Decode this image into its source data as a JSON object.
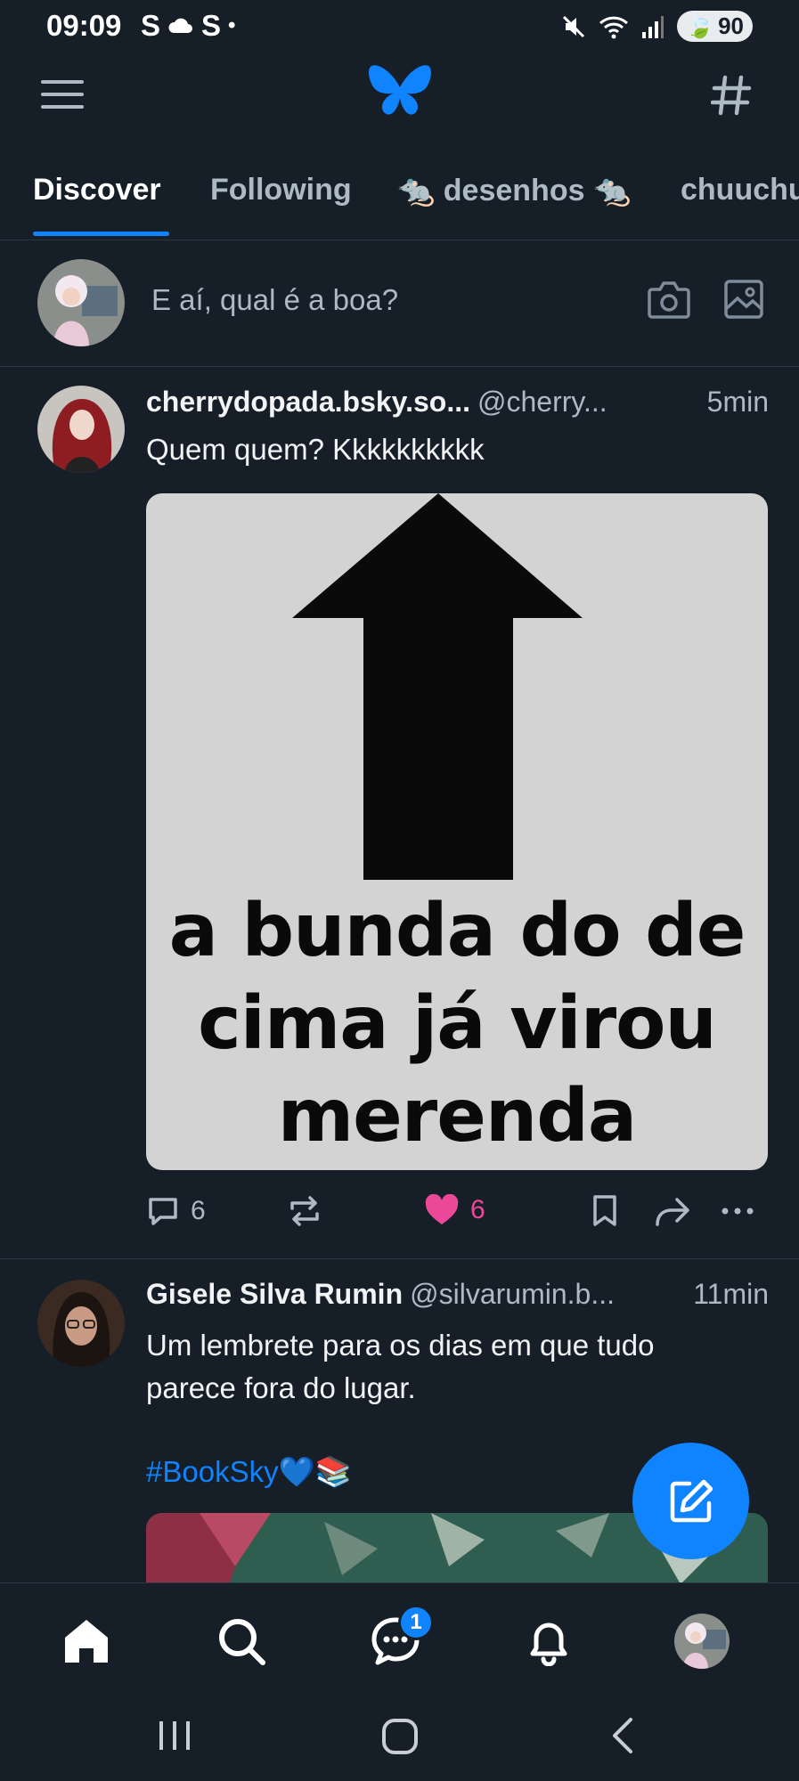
{
  "status_bar": {
    "time": "09:09",
    "left_icons": [
      "S",
      "cloud-icon",
      "S",
      "•"
    ],
    "battery": "90"
  },
  "tabs": [
    {
      "label": "Discover",
      "active": true
    },
    {
      "label": "Following",
      "active": false
    },
    {
      "label": "🐀 desenhos 🐀",
      "active": false
    },
    {
      "label": "chuuchu",
      "active": false
    }
  ],
  "composer": {
    "placeholder": "E aí, qual é a boa?"
  },
  "posts": [
    {
      "author": "cherrydopada.bsky.so...",
      "handle": "@cherry...",
      "time": "5min",
      "text": "Quem quem? Kkkkkkkkkk",
      "image_text": [
        "a bunda do de",
        "cima já virou",
        "merenda"
      ],
      "replies": "6",
      "likes": "6",
      "liked": true
    },
    {
      "author": "Gisele Silva Rumin",
      "handle": "@silvarumin.b...",
      "time": "11min",
      "text_lines": [
        "Um lembrete para os dias em que tudo",
        "parece fora do lugar."
      ],
      "hashtag": "#BookSky💙📚"
    }
  ],
  "bottom_nav": {
    "chat_badge": "1"
  },
  "colors": {
    "background": "#161e27",
    "accent": "#1083fe",
    "like": "#ec4899",
    "muted": "#aeb9c6"
  }
}
